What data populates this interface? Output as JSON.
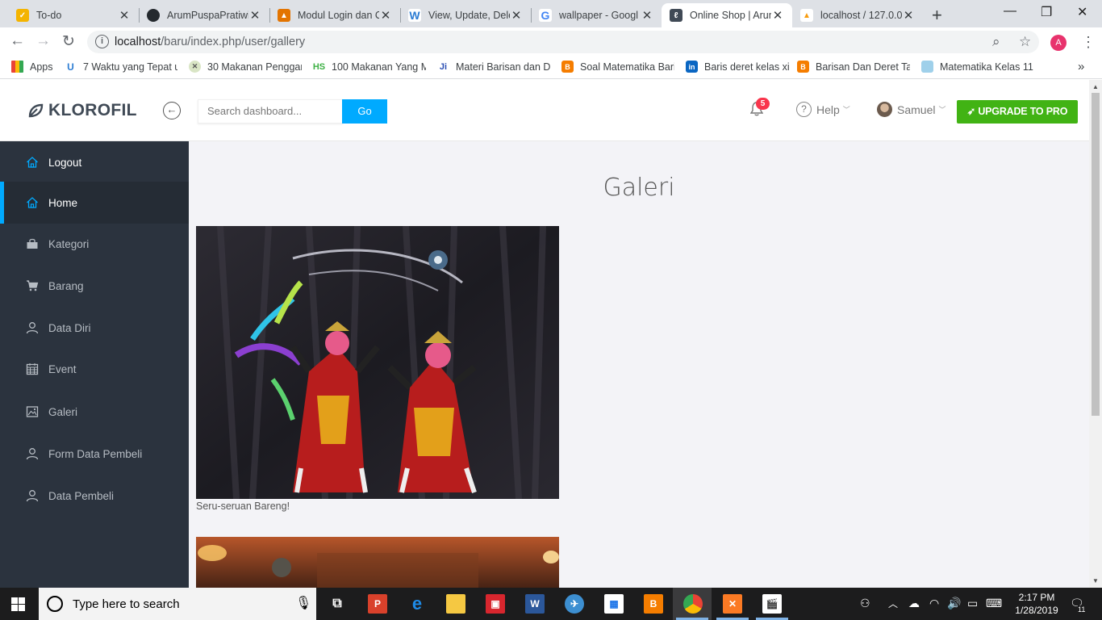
{
  "browser": {
    "tabs": [
      {
        "title": "To-do",
        "icon": "todo-icon",
        "color": "#f4b400"
      },
      {
        "title": "ArumPuspaPratiwi",
        "icon": "github-icon",
        "color": "#24292e"
      },
      {
        "title": "Modul Login dan C",
        "icon": "course-icon",
        "color": "#e37400"
      },
      {
        "title": "View, Update, Dele",
        "icon": "word-icon",
        "color": "#2b7cd3"
      },
      {
        "title": "wallpaper - Googl",
        "icon": "google-icon",
        "color": "#4285f4"
      },
      {
        "title": "Online Shop | Arun",
        "icon": "klorofil-icon",
        "color": "#404a56"
      },
      {
        "title": "localhost / 127.0.0",
        "icon": "phpmyadmin-icon",
        "color": "#f89c0e"
      }
    ],
    "url_host": "localhost",
    "url_path": "/baru/index.php/user/gallery",
    "profile_initial": "A",
    "bookmarks": [
      {
        "label": "Apps"
      },
      {
        "label": "7 Waktu yang Tepat u"
      },
      {
        "label": "30 Makanan Penggar"
      },
      {
        "label": "100 Makanan Yang M"
      },
      {
        "label": "Materi Barisan dan D"
      },
      {
        "label": "Soal Matematika Bari"
      },
      {
        "label": "Baris deret kelas xi"
      },
      {
        "label": "Barisan Dan Deret Tal"
      },
      {
        "label": "Matematika Kelas 11"
      }
    ]
  },
  "app": {
    "brand": "KLOROFIL",
    "search_placeholder": "Search dashboard...",
    "go_label": "Go",
    "notification_count": "5",
    "help_label": "Help",
    "user_name": "Samuel",
    "upgrade_label": "UPGRADE TO PRO",
    "accent_color": "#00aaff",
    "upgrade_color": "#41b314"
  },
  "sidebar": {
    "items": [
      {
        "label": "Logout",
        "icon": "home-icon"
      },
      {
        "label": "Home",
        "icon": "home-icon"
      },
      {
        "label": "Kategori",
        "icon": "bag-icon"
      },
      {
        "label": "Barang",
        "icon": "cart-icon"
      },
      {
        "label": "Data Diri",
        "icon": "user-icon"
      },
      {
        "label": "Event",
        "icon": "calendar-icon"
      },
      {
        "label": "Galeri",
        "icon": "picture-icon"
      },
      {
        "label": "Form Data Pembeli",
        "icon": "user-icon"
      },
      {
        "label": "Data Pembeli",
        "icon": "user-icon"
      }
    ]
  },
  "main": {
    "title": "Galeri",
    "photos": [
      {
        "caption": "Seru-seruan Bareng!"
      }
    ]
  },
  "taskbar": {
    "search_placeholder": "Type here to search",
    "time": "2:17 PM",
    "date": "1/28/2019",
    "notification_count": "11"
  }
}
